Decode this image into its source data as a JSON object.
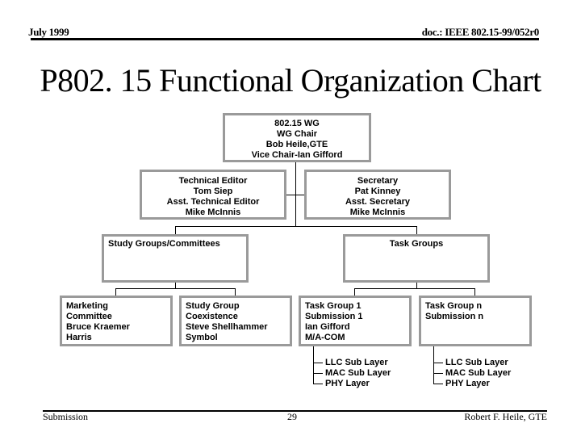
{
  "header": {
    "date": "July 1999",
    "doc_id": "doc.: IEEE 802.15-99/052r0"
  },
  "title": "P802. 15 Functional Organization Chart",
  "org_chart": {
    "top": {
      "lines": [
        "802.15 WG",
        "WG Chair",
        "Bob Heile,GTE",
        "Vice Chair-Ian Gifford"
      ]
    },
    "technical_editor": {
      "lines": [
        "Technical Editor",
        "Tom Siep",
        "Asst. Technical Editor",
        "Mike McInnis"
      ]
    },
    "secretary": {
      "lines": [
        "Secretary",
        "Pat Kinney",
        "Asst. Secretary",
        "Mike McInnis"
      ]
    },
    "study_groups": {
      "title": "Study Groups/Committees",
      "children": [
        {
          "lines": [
            "Marketing",
            "Committee",
            "Bruce Kraemer",
            "Harris"
          ]
        },
        {
          "lines": [
            "Study Group",
            "Coexistence",
            "Steve Shellhammer",
            "Symbol"
          ]
        }
      ]
    },
    "task_groups": {
      "title": "Task Groups",
      "children": [
        {
          "lines": [
            "Task Group 1",
            "Submission 1",
            "Ian Gifford",
            "M/A-COM"
          ],
          "sublayers": [
            "LLC Sub Layer",
            "MAC Sub Layer",
            "PHY Layer"
          ]
        },
        {
          "lines": [
            "Task Group n",
            "Submission n"
          ],
          "sublayers": [
            "LLC Sub Layer",
            "MAC Sub Layer",
            "PHY Layer"
          ]
        }
      ]
    }
  },
  "footer": {
    "left": "Submission",
    "page_number": "29",
    "author": "Robert F. Heile, GTE"
  }
}
